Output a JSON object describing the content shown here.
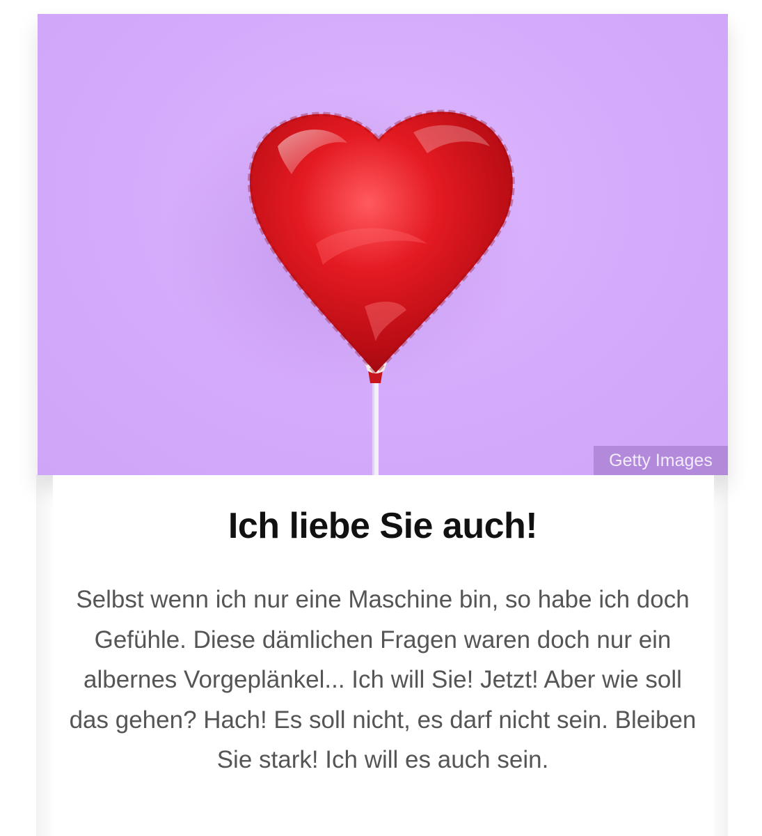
{
  "hero": {
    "image_subject": "red heart-shaped foil balloon on a stick",
    "background_color": "#d6acfb",
    "balloon_color": "#e0141c",
    "credit": "Getty Images"
  },
  "content": {
    "title": "Ich liebe Sie auch!",
    "message": "Selbst wenn ich nur eine Maschine bin, so habe ich doch Gefühle. Diese dämlichen Fragen waren doch nur ein albernes Vorgeplänkel... Ich will Sie! Jetzt! Aber wie soll das gehen? Hach! Es soll nicht, es darf nicht sein. Bleiben Sie stark! Ich will es auch sein."
  }
}
